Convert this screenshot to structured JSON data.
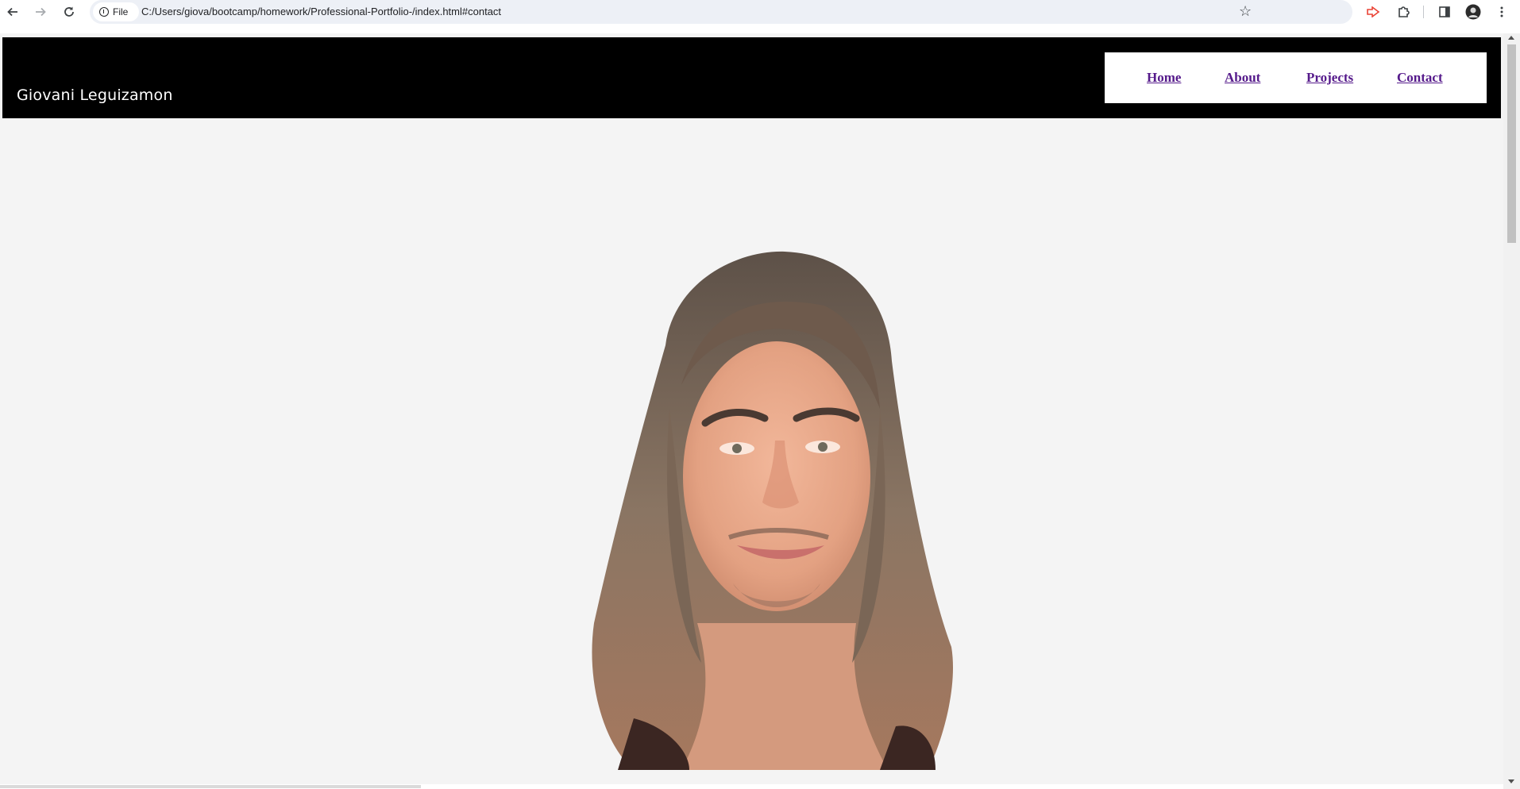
{
  "browser": {
    "address_chip": "File",
    "url": "C:/Users/giova/bootcamp/homework/Professional-Portfolio-/index.html#contact"
  },
  "site": {
    "name": "Giovani Leguizamon",
    "nav": [
      {
        "label": "Home"
      },
      {
        "label": "About"
      },
      {
        "label": "Projects"
      },
      {
        "label": "Contact"
      }
    ],
    "portrait_subject": "portrait photo of a smiling man with long hair"
  },
  "colors": {
    "header_bg": "#000000",
    "page_bg": "#f4f4f4",
    "nav_bg": "#ffffff",
    "link_visited": "#551a8b"
  }
}
